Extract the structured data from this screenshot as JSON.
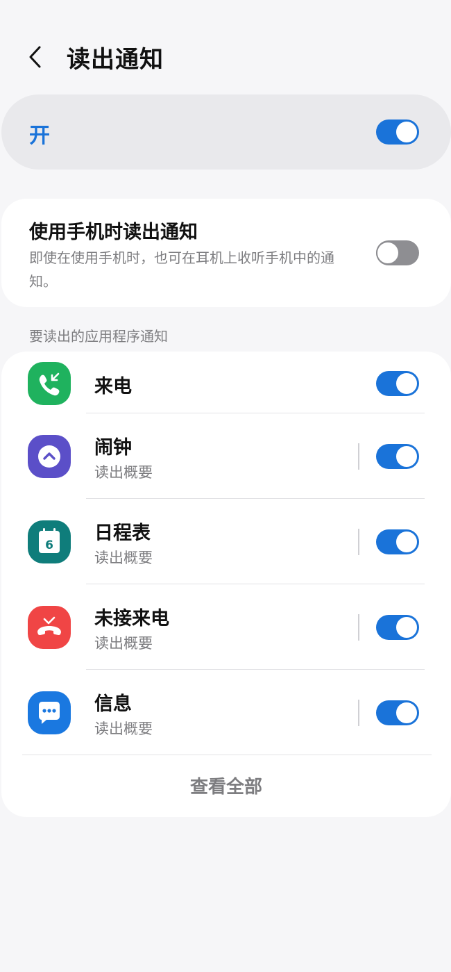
{
  "header": {
    "title": "读出通知"
  },
  "master": {
    "label": "开",
    "enabled": true
  },
  "phone_use": {
    "title": "使用手机时读出通知",
    "description": "即使在使用手机时，也可在耳机上收听手机中的通知。",
    "enabled": false
  },
  "section": {
    "label": "要读出的应用程序通知"
  },
  "apps": [
    {
      "name": "来电",
      "subtitle": "",
      "icon": "incoming-call-icon",
      "color": "#1fb25e",
      "enabled": true
    },
    {
      "name": "闹钟",
      "subtitle": "读出概要",
      "icon": "alarm-icon",
      "color": "#5b4fc8",
      "enabled": true
    },
    {
      "name": "日程表",
      "subtitle": "读出概要",
      "icon": "calendar-icon",
      "color": "#0f7d7b",
      "enabled": true,
      "icon_text": "6"
    },
    {
      "name": "未接来电",
      "subtitle": "读出概要",
      "icon": "missed-call-icon",
      "color": "#f04545",
      "enabled": true
    },
    {
      "name": "信息",
      "subtitle": "读出概要",
      "icon": "message-icon",
      "color": "#1a78e0",
      "enabled": true
    }
  ],
  "footer": {
    "view_all": "查看全部"
  },
  "colors": {
    "accent": "#1a73d9",
    "background": "#f6f6f8",
    "card": "#ffffff"
  }
}
